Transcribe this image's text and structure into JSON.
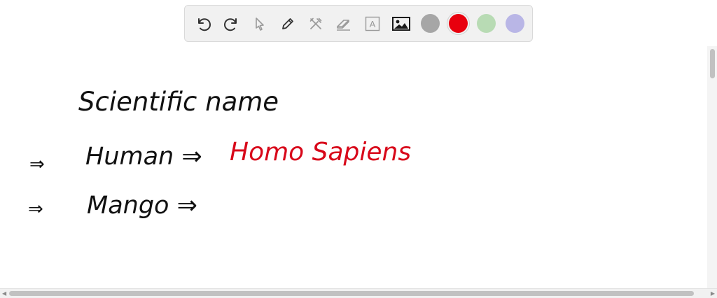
{
  "toolbar": {
    "tools": [
      {
        "icon": "undo-icon"
      },
      {
        "icon": "redo-icon"
      },
      {
        "icon": "pointer-icon"
      },
      {
        "icon": "pen-icon"
      },
      {
        "icon": "tools-icon"
      },
      {
        "icon": "eraser-icon"
      },
      {
        "icon": "text-icon",
        "label": "A"
      },
      {
        "icon": "image-icon"
      }
    ],
    "colors": [
      "#a6a6a6",
      "#e8000e",
      "#b8dbb4",
      "#b9b6e6"
    ],
    "active_color": "#e8000e"
  },
  "canvas": {
    "heading": "Scientific name",
    "rows": [
      {
        "bullet": "⇒",
        "term": "Human ⇒",
        "answer": "Homo Sapiens"
      },
      {
        "bullet": "⇒",
        "term": "Mango ⇒",
        "answer": ""
      }
    ],
    "ink_color": "#111111",
    "answer_color": "#d8081a"
  }
}
